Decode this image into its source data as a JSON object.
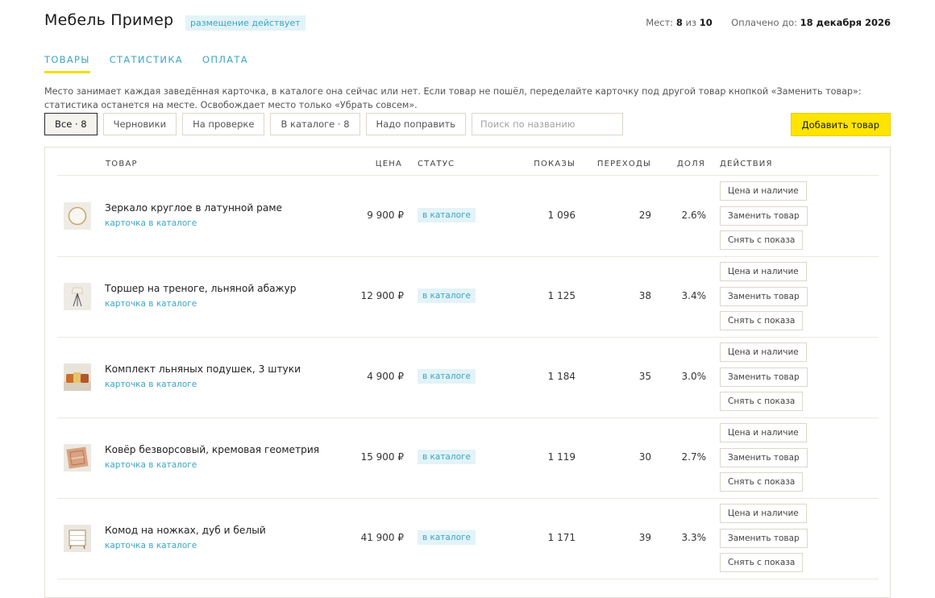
{
  "header": {
    "title": "Мебель Пример",
    "placement_badge": "размещение действует",
    "slots_label": "Мест:",
    "slots_used": "8",
    "slots_of": "из",
    "slots_total": "10",
    "paid_label": "Оплачено до:",
    "paid_until": "18 декабря 2026"
  },
  "tabs": [
    {
      "label": "ТОВАРЫ",
      "active": true
    },
    {
      "label": "СТАТИСТИКА",
      "active": false
    },
    {
      "label": "ОПЛАТА",
      "active": false
    }
  ],
  "info_text": "Место занимает каждая заведённая карточка, в каталоге она сейчас или нет. Если товар не пошёл, переделайте карточку под другой товар кнопкой «Заменить товар»: статистика останется на месте. Освобождает место только «Убрать совсем».",
  "filters": [
    {
      "label": "Все · 8",
      "active": true
    },
    {
      "label": "Черновики",
      "active": false
    },
    {
      "label": "На проверке",
      "active": false
    },
    {
      "label": "В каталоге · 8",
      "active": false
    },
    {
      "label": "Надо поправить",
      "active": false
    }
  ],
  "search": {
    "placeholder": "Поиск по названию",
    "value": ""
  },
  "add_button": "Добавить товар",
  "table": {
    "columns": {
      "product": "ТОВАР",
      "price": "ЦЕНА",
      "status": "СТАТУС",
      "views": "ПОКАЗЫ",
      "clicks": "ПЕРЕХОДЫ",
      "share": "ДОЛЯ",
      "actions": "ДЕЙСТВИЯ"
    },
    "action_labels": {
      "price_stock": "Цена и наличие",
      "replace": "Заменить товар",
      "hide": "Снять с показа"
    },
    "rows": [
      {
        "name": "Зеркало круглое в латунной раме",
        "link": "карточка в каталоге",
        "price": "9 900 ₽",
        "status": "в каталоге",
        "views": "1 096",
        "clicks": "29",
        "share": "2.6%",
        "thumb_icon": "round-mirror-icon"
      },
      {
        "name": "Торшер на треноге, льняной абажур",
        "link": "карточка в каталоге",
        "price": "12 900 ₽",
        "status": "в каталоге",
        "views": "1 125",
        "clicks": "38",
        "share": "3.4%",
        "thumb_icon": "floor-lamp-icon"
      },
      {
        "name": "Комплект льняных подушек, 3 штуки",
        "link": "карточка в каталоге",
        "price": "4 900 ₽",
        "status": "в каталоге",
        "views": "1 184",
        "clicks": "35",
        "share": "3.0%",
        "thumb_icon": "pillows-icon"
      },
      {
        "name": "Ковёр безворсовый, кремовая геометрия",
        "link": "карточка в каталоге",
        "price": "15 900 ₽",
        "status": "в каталоге",
        "views": "1 119",
        "clicks": "30",
        "share": "2.7%",
        "thumb_icon": "rug-icon"
      },
      {
        "name": "Комод на ножках, дуб и белый",
        "link": "карточка в каталоге",
        "price": "41 900 ₽",
        "status": "в каталоге",
        "views": "1 171",
        "clicks": "39",
        "share": "3.3%",
        "thumb_icon": "dresser-icon"
      }
    ]
  },
  "colors": {
    "accent": "#3ba5c4",
    "brand_yellow": "#ffe400",
    "badge_bg": "#e3f3f8"
  }
}
